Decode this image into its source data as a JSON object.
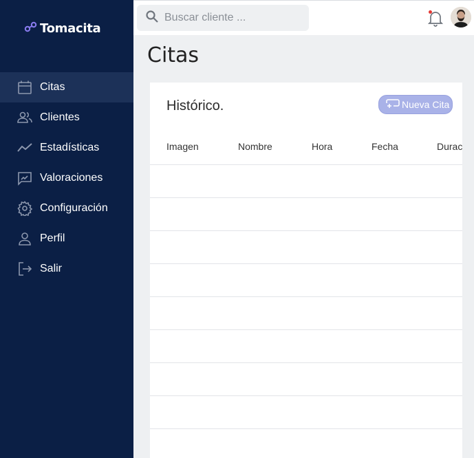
{
  "brand": {
    "name": "Tomacita"
  },
  "sidebar": {
    "items": [
      {
        "label": "Citas",
        "icon": "calendar-icon",
        "active": true
      },
      {
        "label": "Clientes",
        "icon": "users-icon",
        "active": false
      },
      {
        "label": "Estadísticas",
        "icon": "trend-icon",
        "active": false
      },
      {
        "label": "Valoraciones",
        "icon": "feedback-icon",
        "active": false
      },
      {
        "label": "Configuración",
        "icon": "gear-icon",
        "active": false
      },
      {
        "label": "Perfil",
        "icon": "person-icon",
        "active": false
      },
      {
        "label": "Salir",
        "icon": "logout-icon",
        "active": false
      }
    ]
  },
  "topbar": {
    "search_placeholder": "Buscar cliente ...",
    "notification_icon": "bell-icon",
    "has_unread": true
  },
  "page": {
    "title": "Citas"
  },
  "card": {
    "title": "Histórico.",
    "new_button_label": "Nueva Cita",
    "columns": [
      "Imagen",
      "Nombre",
      "Hora",
      "Fecha",
      "Duración"
    ],
    "rows": []
  },
  "colors": {
    "sidebar_bg": "#0b1f45",
    "sidebar_active_bg": "#1c3158",
    "accent_button": "#a9b2e8",
    "page_bg": "#eef0f2"
  }
}
